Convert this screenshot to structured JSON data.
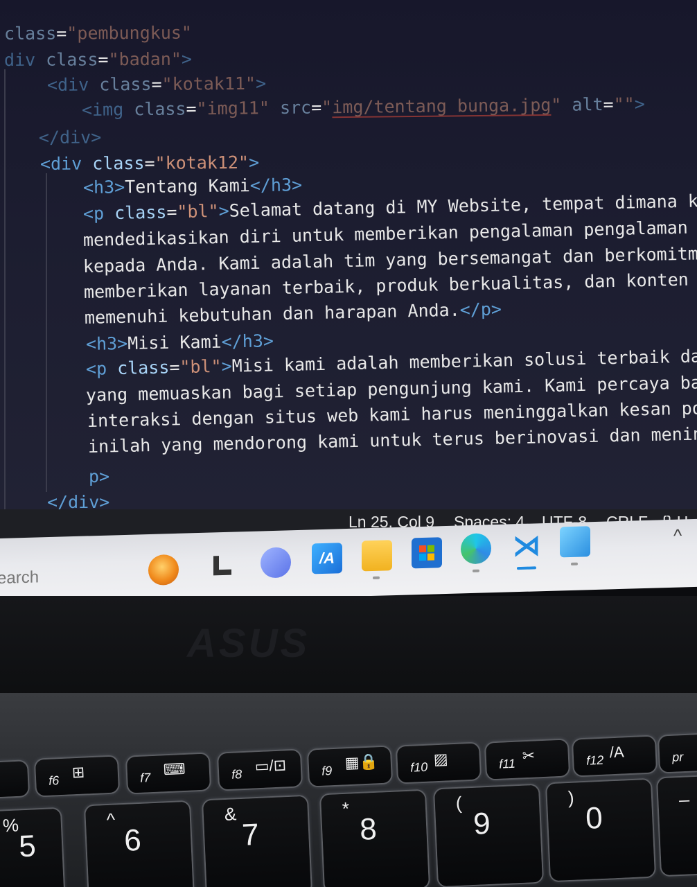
{
  "editor": {
    "lines": [
      {
        "id": "l1",
        "tokens": [
          [
            "attr",
            "class"
          ],
          [
            "txt",
            "="
          ],
          [
            "str",
            "\"pembungkus\""
          ]
        ]
      },
      {
        "id": "l2",
        "tokens": [
          [
            "tag",
            "div "
          ],
          [
            "attr",
            "class"
          ],
          [
            "txt",
            "="
          ],
          [
            "str",
            "\"badan\""
          ],
          [
            "tag",
            ">"
          ]
        ]
      },
      {
        "id": "l3",
        "tokens": [
          [
            "tag",
            "<div "
          ],
          [
            "attr",
            "class"
          ],
          [
            "txt",
            "="
          ],
          [
            "str",
            "\"kotak11\""
          ],
          [
            "tag",
            ">"
          ]
        ]
      },
      {
        "id": "l4",
        "tokens": [
          [
            "tag",
            "<img "
          ],
          [
            "attr",
            "class"
          ],
          [
            "txt",
            "="
          ],
          [
            "str",
            "\"img11\" "
          ],
          [
            "attr",
            "src"
          ],
          [
            "txt",
            "="
          ],
          [
            "str",
            "\""
          ],
          [
            "strU",
            "img/tentang bunga.jpg"
          ],
          [
            "str",
            "\" "
          ],
          [
            "attr",
            "alt"
          ],
          [
            "txt",
            "="
          ],
          [
            "str",
            "\"\""
          ],
          [
            "tag",
            ">"
          ]
        ]
      },
      {
        "id": "l5",
        "tokens": [
          [
            "tag",
            "</div>"
          ]
        ]
      },
      {
        "id": "l6",
        "tokens": [
          [
            "tag",
            "<div "
          ],
          [
            "attr",
            "class"
          ],
          [
            "txt",
            "="
          ],
          [
            "str",
            "\"kotak12\""
          ],
          [
            "tag",
            ">"
          ]
        ]
      },
      {
        "id": "l7",
        "tokens": [
          [
            "tag",
            "<h3>"
          ],
          [
            "txt",
            "Tentang Kami"
          ],
          [
            "tag",
            "</h3>"
          ]
        ]
      },
      {
        "id": "l8",
        "tokens": [
          [
            "tag",
            "<p "
          ],
          [
            "attr",
            "class"
          ],
          [
            "txt",
            "="
          ],
          [
            "str",
            "\"bl\""
          ],
          [
            "tag",
            ">"
          ],
          [
            "txt",
            "Selamat datang di MY Website, tempat dimana k"
          ]
        ]
      },
      {
        "id": "l9",
        "tokens": [
          [
            "txt",
            "mendedikasikan diri untuk memberikan pengalaman pengalaman"
          ]
        ]
      },
      {
        "id": "l10",
        "tokens": [
          [
            "txt",
            "kepada Anda. Kami adalah tim yang bersemangat dan berkomitm"
          ]
        ]
      },
      {
        "id": "l11",
        "tokens": [
          [
            "txt",
            "memberikan layanan terbaik, produk berkualitas, dan konten"
          ]
        ]
      },
      {
        "id": "l12",
        "tokens": [
          [
            "txt",
            "memenuhi kebutuhan dan harapan Anda."
          ],
          [
            "tag",
            "</p>"
          ]
        ]
      },
      {
        "id": "l13",
        "tokens": [
          [
            "tag",
            "<h3>"
          ],
          [
            "txt",
            "Misi Kami"
          ],
          [
            "tag",
            "</h3>"
          ]
        ]
      },
      {
        "id": "l14",
        "tokens": [
          [
            "tag",
            "<p "
          ],
          [
            "attr",
            "class"
          ],
          [
            "txt",
            "="
          ],
          [
            "str",
            "\"bl\""
          ],
          [
            "tag",
            ">"
          ],
          [
            "txt",
            "Misi kami adalah memberikan solusi terbaik da"
          ]
        ]
      },
      {
        "id": "l15",
        "tokens": [
          [
            "txt",
            "yang memuaskan bagi setiap pengunjung kami. Kami percaya ba"
          ]
        ]
      },
      {
        "id": "l16",
        "tokens": [
          [
            "txt",
            "interaksi dengan situs web kami harus meninggalkan kesan po"
          ]
        ]
      },
      {
        "id": "l17",
        "tokens": [
          [
            "txt",
            "inilah yang mendorong kami untuk terus berinovasi dan menin"
          ]
        ]
      },
      {
        "id": "l18",
        "tokens": [
          [
            "tag",
            "p>"
          ]
        ]
      },
      {
        "id": "l19",
        "tokens": [
          [
            "tag",
            "</div>"
          ]
        ]
      }
    ],
    "colors": {
      "tag": "#5f9fd6",
      "attr": "#a8d4f7",
      "string": "#ce9178",
      "text": "#e8e8e8",
      "background": "#1c1d30"
    }
  },
  "status_bar": {
    "position": "Ln 25, Col 9",
    "spaces": "Spaces: 4",
    "encoding": "UTF-8",
    "eol": "CRLF",
    "language_icon": "{} H"
  },
  "taskbar": {
    "search_text": "earch",
    "icons": [
      "chrome-ball-icon",
      "file-explorer-l-icon",
      "meet-chat-icon",
      "asus-app-icon",
      "folder-icon",
      "microsoft-store-icon",
      "edge-icon",
      "vscode-icon",
      "photos-icon"
    ],
    "tray_chevron": "^"
  },
  "laptop": {
    "brand": "ASUS",
    "function_keys": [
      {
        "label": "f6",
        "icon": "⊞"
      },
      {
        "label": "f7",
        "icon": "⌨"
      },
      {
        "label": "f8",
        "icon": "▭/⊡"
      },
      {
        "label": "f9",
        "icon": "▦🔒"
      },
      {
        "label": "f10",
        "icon": "▨"
      },
      {
        "label": "f11",
        "icon": "✂"
      },
      {
        "label": "f12",
        "icon": "/A"
      },
      {
        "label": "pr",
        "icon": ""
      }
    ],
    "number_keys": [
      {
        "symbol": "%",
        "digit": "5"
      },
      {
        "symbol": "^",
        "digit": "6"
      },
      {
        "symbol": "&",
        "digit": "7"
      },
      {
        "symbol": "*",
        "digit": "8"
      },
      {
        "symbol": "(",
        "digit": "9"
      },
      {
        "symbol": ")",
        "digit": "0"
      },
      {
        "symbol": "_",
        "digit": ""
      }
    ]
  }
}
